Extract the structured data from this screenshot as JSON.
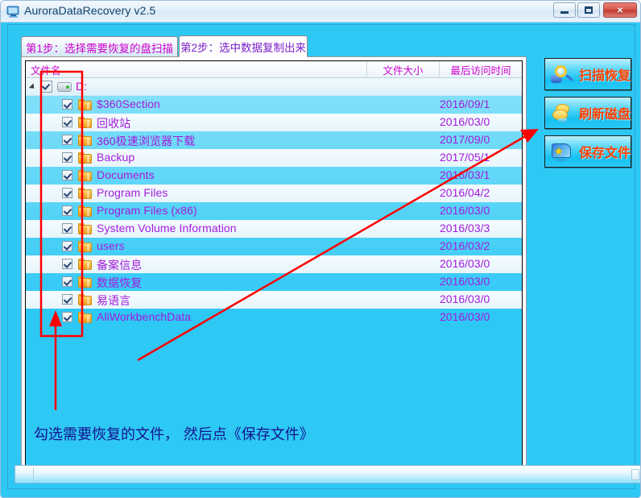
{
  "window": {
    "title": "AuroraDataRecovery v2.5",
    "icon": "monitor-icon",
    "minimize_label": "Minimize",
    "maximize_label": "Maximize",
    "close_label": "×"
  },
  "tabs": [
    {
      "label": "第1步：选择需要恢复的盘扫描",
      "active": false,
      "color": "#cc00cc"
    },
    {
      "label": "第2步：选中数据复制出来",
      "active": true,
      "color": "#7a22c8"
    }
  ],
  "list": {
    "columns": [
      {
        "key": "name",
        "label": "文件名"
      },
      {
        "key": "size",
        "label": "文件大小"
      },
      {
        "key": "time",
        "label": "最后访问时间"
      }
    ],
    "root": {
      "label": "D:",
      "checked": true,
      "expanded": true,
      "icon": "drive-icon",
      "size": "",
      "time": ""
    },
    "rows": [
      {
        "label": "$360Section",
        "checked": true,
        "icon": "folder-icon",
        "size": "",
        "time": "2016/09/1"
      },
      {
        "label": "回收站",
        "checked": true,
        "icon": "folder-icon",
        "size": "",
        "time": "2016/03/0"
      },
      {
        "label": "360极速浏览器下载",
        "checked": true,
        "icon": "folder-icon",
        "size": "",
        "time": "2017/09/0"
      },
      {
        "label": "Backup",
        "checked": true,
        "icon": "folder-icon",
        "size": "",
        "time": "2017/05/1"
      },
      {
        "label": "Documents",
        "checked": true,
        "icon": "folder-icon",
        "size": "",
        "time": "2016/03/1"
      },
      {
        "label": "Program Files",
        "checked": true,
        "icon": "folder-icon",
        "size": "",
        "time": "2016/04/2"
      },
      {
        "label": "Program Files (x86)",
        "checked": true,
        "icon": "folder-icon",
        "size": "",
        "time": "2016/03/0"
      },
      {
        "label": "System Volume Information",
        "checked": true,
        "icon": "folder-icon",
        "size": "",
        "time": "2016/03/3"
      },
      {
        "label": "users",
        "checked": true,
        "icon": "folder-icon",
        "size": "",
        "time": "2016/03/2"
      },
      {
        "label": "备案信息",
        "checked": true,
        "icon": "folder-icon",
        "size": "",
        "time": "2016/03/0"
      },
      {
        "label": "数据恢复",
        "checked": true,
        "icon": "folder-icon",
        "size": "",
        "time": "2016/03/0"
      },
      {
        "label": "易语言",
        "checked": true,
        "icon": "folder-icon",
        "size": "",
        "time": "2016/03/0"
      },
      {
        "label": "AliWorkbenchData",
        "checked": true,
        "icon": "folder-icon",
        "size": "",
        "time": "2016/03/0"
      }
    ],
    "scrollbar": {
      "left_arrow": "◄",
      "right_arrow": "►"
    }
  },
  "annotation": {
    "text": "勾选需要恢复的文件，  然后点《保存文件》",
    "color": "#14148c",
    "marker_color": "#ff0000"
  },
  "sidebar": {
    "buttons": [
      {
        "label": "扫描恢复",
        "icon": "magnifier-icon",
        "color": "#ff4000"
      },
      {
        "label": "刷新磁盘",
        "icon": "disk-refresh-icon",
        "color": "#ff4000"
      },
      {
        "label": "保存文件",
        "icon": "save-star-icon",
        "color": "#ff4000"
      }
    ]
  },
  "statusbar": {
    "text": ""
  },
  "colors": {
    "client_background": "#2ec8f5",
    "accent_magenta": "#cc00cc",
    "item_purple": "#a41bdc",
    "button_text": "#ff4000",
    "annotation_red": "#ff0000",
    "annotation_blue": "#14148c"
  }
}
